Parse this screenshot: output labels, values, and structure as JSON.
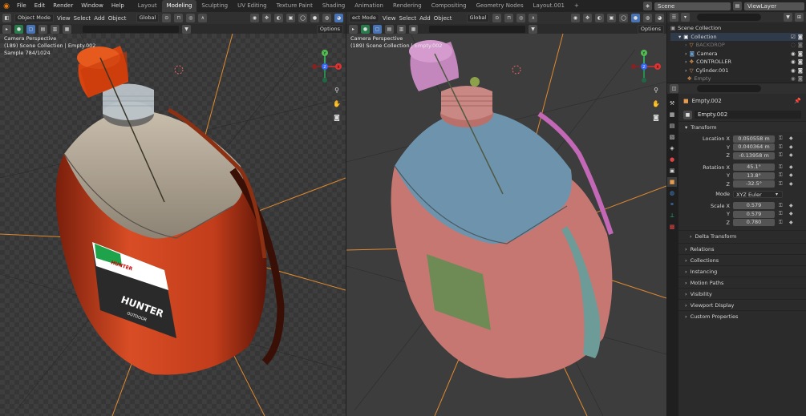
{
  "app": {
    "menu": [
      "File",
      "Edit",
      "Render",
      "Window",
      "Help"
    ],
    "workspaces": [
      "Layout",
      "Modeling",
      "Sculpting",
      "UV Editing",
      "Texture Paint",
      "Shading",
      "Animation",
      "Rendering",
      "Compositing",
      "Geometry Nodes",
      "Layout.001"
    ],
    "active_workspace": "Modeling",
    "add_tab": "+",
    "scene": "Scene",
    "view_layer": "ViewLayer"
  },
  "left_viewport": {
    "mode": "Object Mode",
    "menu": [
      "View",
      "Select",
      "Add",
      "Object"
    ],
    "transform_orientation": "Global",
    "options": "Options",
    "overlay": [
      "Camera Perspective",
      "(189) Scene Collection | Empty.002",
      "Sample 784/1024"
    ],
    "label": {
      "logo": "HUNTER",
      "brand": "HUNTER",
      "tagline": "OUTDOOR"
    },
    "gizmo": {
      "x": "X",
      "y": "Y",
      "z": "Z"
    }
  },
  "right_viewport": {
    "mode": "ect Mode",
    "menu": [
      "View",
      "Select",
      "Add",
      "Object"
    ],
    "transform_orientation": "Global",
    "options": "Options",
    "overlay": [
      "Camera Perspective",
      "(189) Scene Collection | Empty.002"
    ],
    "gizmo": {
      "x": "X",
      "y": "Y",
      "z": "Z"
    }
  },
  "outliner": {
    "root": "Scene Collection",
    "collection": "Collection",
    "items": [
      "BACKDROP",
      "Camera",
      "CONTROLLER",
      "Cylinder.001",
      "Empty"
    ]
  },
  "properties": {
    "object_name": "Empty.002",
    "data_name": "Empty.002",
    "transform_label": "Transform",
    "location": {
      "label": "Location X",
      "x": "0.050558 m",
      "y": "0.040364 m",
      "z": "-0.13958 m"
    },
    "rotation": {
      "label": "Rotation X",
      "x": "45.1°",
      "y": "13.8°",
      "z": "-32.5°"
    },
    "mode": {
      "label": "Mode",
      "value": "XYZ Euler"
    },
    "scale": {
      "label": "Scale X",
      "x": "0.579",
      "y": "0.579",
      "z": "0.780"
    },
    "axis": {
      "y": "Y",
      "z": "Z"
    },
    "delta": "Delta Transform",
    "panels": [
      "Relations",
      "Collections",
      "Instancing",
      "Motion Paths",
      "Visibility",
      "Viewport Display",
      "Custom Properties"
    ]
  }
}
